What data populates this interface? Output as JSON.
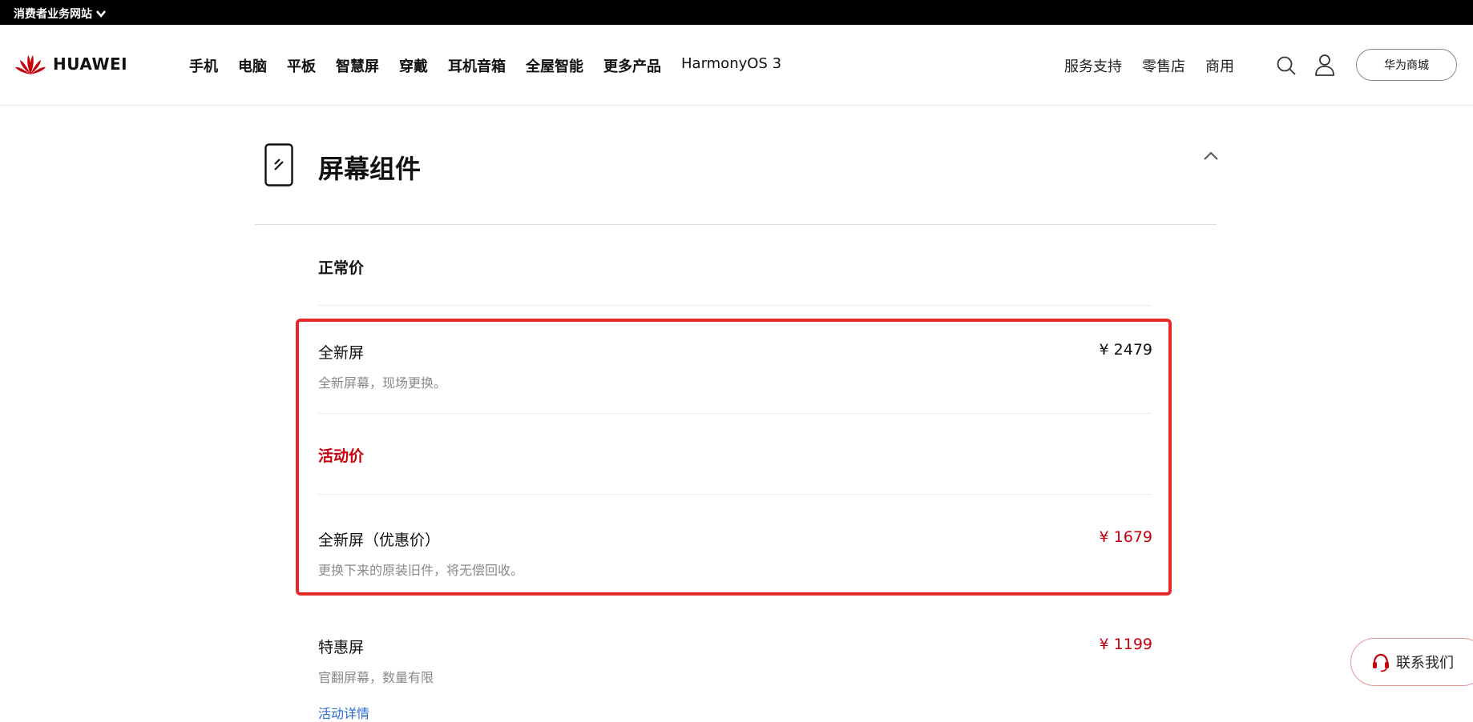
{
  "topbar": {
    "site_label": "消费者业务网站"
  },
  "header": {
    "brand": "HUAWEI",
    "nav": [
      "手机",
      "电脑",
      "平板",
      "智慧屏",
      "穿戴",
      "耳机音箱",
      "全屋智能",
      "更多产品",
      "HarmonyOS 3"
    ],
    "right_links": [
      "服务支持",
      "零售店",
      "商用"
    ],
    "mall_button": "华为商城"
  },
  "section": {
    "title": "屏幕组件",
    "normal_label": "正常价",
    "activity_label": "活动价",
    "items": [
      {
        "title": "全新屏",
        "desc": "全新屏幕，现场更换。",
        "price": "¥ 2479"
      },
      {
        "title": "全新屏（优惠价）",
        "desc": "更换下来的原装旧件，将无偿回收。",
        "price": "¥ 1679"
      },
      {
        "title": "特惠屏",
        "desc": "官翻屏幕，数量有限",
        "price": "¥ 1199",
        "link": "活动详情"
      }
    ]
  },
  "contact": {
    "label": "联系我们"
  },
  "colors": {
    "accent_red": "#c7000b",
    "highlight_border": "#e52b27",
    "link_blue": "#2a6bd1"
  }
}
